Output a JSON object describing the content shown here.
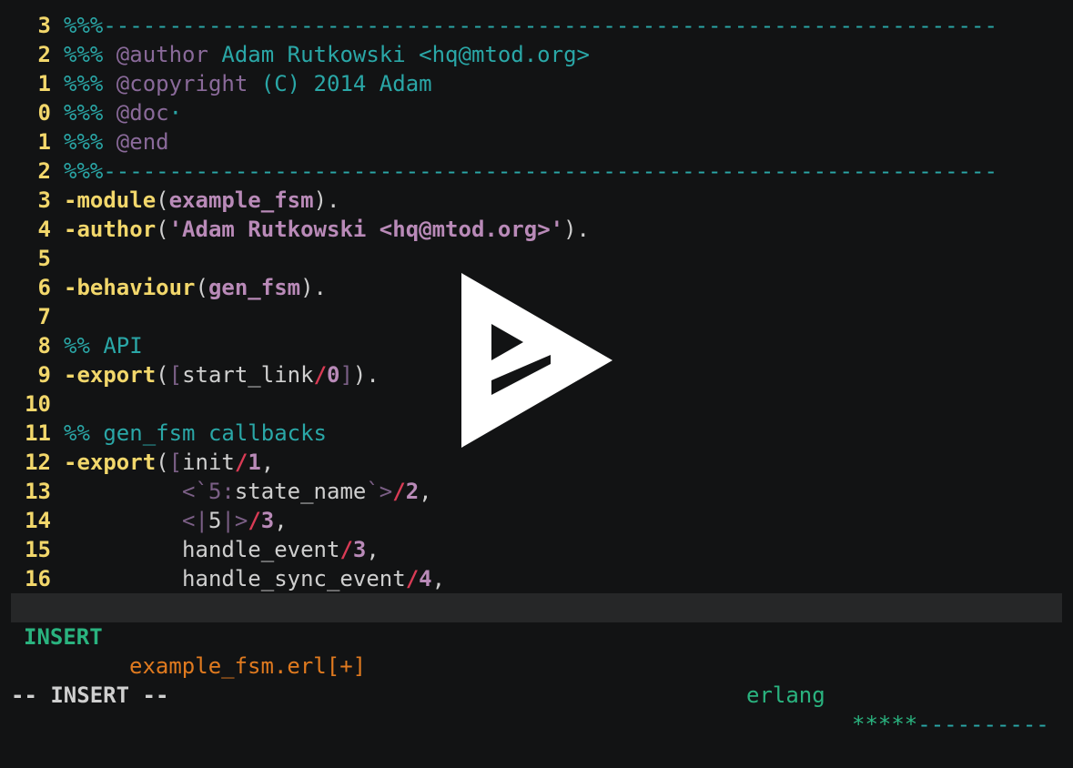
{
  "editor": {
    "lines": [
      {
        "num": "3",
        "parts": [
          [
            "cm",
            "%%%--------------------------------------------------------------------"
          ]
        ]
      },
      {
        "num": "2",
        "parts": [
          [
            "cm",
            "%%% "
          ],
          [
            "cmtag",
            "@author"
          ],
          [
            "cm",
            " Adam Rutkowski <hq@mtod.org>"
          ]
        ]
      },
      {
        "num": "1",
        "parts": [
          [
            "cm",
            "%%% "
          ],
          [
            "cmtag",
            "@copyright"
          ],
          [
            "cm",
            " (C) 2014 Adam"
          ]
        ]
      },
      {
        "num": "0",
        "parts": [
          [
            "cm",
            "%%% "
          ],
          [
            "cmtag",
            "@doc"
          ],
          [
            "cm",
            "·"
          ]
        ]
      },
      {
        "num": "1",
        "parts": [
          [
            "cm",
            "%%% "
          ],
          [
            "cmtag",
            "@end"
          ]
        ]
      },
      {
        "num": "2",
        "parts": [
          [
            "cm",
            "%%%--------------------------------------------------------------------"
          ]
        ]
      },
      {
        "num": "3",
        "parts": [
          [
            "kw",
            "-module"
          ],
          [
            "pl",
            "("
          ],
          [
            "atom",
            "example_fsm"
          ],
          [
            "pl",
            ")."
          ]
        ]
      },
      {
        "num": "4",
        "parts": [
          [
            "kw",
            "-author"
          ],
          [
            "pl",
            "("
          ],
          [
            "str",
            "'Adam Rutkowski <hq@mtod.org>'"
          ],
          [
            "pl",
            ")."
          ]
        ]
      },
      {
        "num": "5",
        "parts": []
      },
      {
        "num": "6",
        "parts": [
          [
            "kw",
            "-behaviour"
          ],
          [
            "pl",
            "("
          ],
          [
            "atom",
            "gen_fsm"
          ],
          [
            "pl",
            ")."
          ]
        ]
      },
      {
        "num": "7",
        "parts": []
      },
      {
        "num": "8",
        "parts": [
          [
            "cm",
            "%% API"
          ]
        ]
      },
      {
        "num": "9",
        "parts": [
          [
            "kw",
            "-export"
          ],
          [
            "pl",
            "("
          ],
          [
            "br",
            "["
          ],
          [
            "pl",
            "start_link"
          ],
          [
            "op",
            "/"
          ],
          [
            "num",
            "0"
          ],
          [
            "br",
            "]"
          ],
          [
            "pl",
            ")."
          ]
        ]
      },
      {
        "num": "10",
        "parts": []
      },
      {
        "num": "11",
        "parts": [
          [
            "cm",
            "%% gen_fsm callbacks"
          ]
        ]
      },
      {
        "num": "12",
        "parts": [
          [
            "kw",
            "-export"
          ],
          [
            "pl",
            "("
          ],
          [
            "br",
            "["
          ],
          [
            "pl",
            "init"
          ],
          [
            "op",
            "/"
          ],
          [
            "num",
            "1"
          ],
          [
            "pl",
            ","
          ]
        ]
      },
      {
        "num": "13",
        "parts": [
          [
            "pl",
            "         "
          ],
          [
            "br",
            "<`5:"
          ],
          [
            "pl",
            "state_name"
          ],
          [
            "br",
            "`>"
          ],
          [
            "op",
            "/"
          ],
          [
            "num",
            "2"
          ],
          [
            "pl",
            ","
          ]
        ]
      },
      {
        "num": "14",
        "parts": [
          [
            "pl",
            "         "
          ],
          [
            "br",
            "<|"
          ],
          [
            "pl",
            "5"
          ],
          [
            "br",
            "|>"
          ],
          [
            "op",
            "/"
          ],
          [
            "num",
            "3"
          ],
          [
            "pl",
            ","
          ]
        ]
      },
      {
        "num": "15",
        "parts": [
          [
            "pl",
            "         handle_event"
          ],
          [
            "op",
            "/"
          ],
          [
            "num",
            "3"
          ],
          [
            "pl",
            ","
          ]
        ]
      },
      {
        "num": "16",
        "parts": [
          [
            "pl",
            "         handle_sync_event"
          ],
          [
            "op",
            "/"
          ],
          [
            "num",
            "4"
          ],
          [
            "pl",
            ","
          ]
        ]
      }
    ]
  },
  "statusbar": {
    "mode": "INSERT",
    "filename": "example_fsm.erl[+]",
    "filetype": "erlang",
    "progress_filled": "*****",
    "progress_rest": "----------"
  },
  "cmdline": "-- INSERT --",
  "colors": {
    "background": "#121314",
    "line_number": "#f2d76b",
    "comment": "#2aa7a7",
    "mode": "#2ab37f",
    "filename": "#e07a1f"
  },
  "overlay": {
    "icon": "play-icon"
  }
}
